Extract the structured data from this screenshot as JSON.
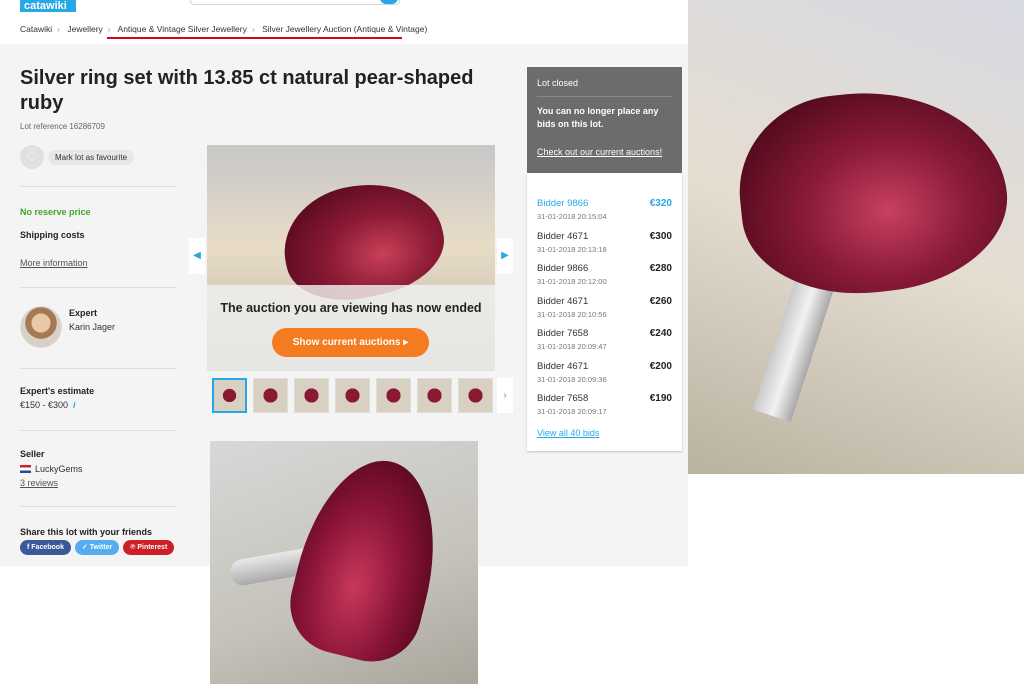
{
  "header": {
    "logo": "catawiki"
  },
  "breadcrumb": [
    "Catawiki",
    "Jewellery",
    "Antique & Vintage Silver Jewellery",
    "Silver Jewellery Auction (Antique & Vintage)"
  ],
  "lot": {
    "title": "Silver ring set with 13.85 ct natural pear-shaped ruby",
    "reference": "Lot reference 16286709",
    "favourite_label": "Mark lot as favourite",
    "no_reserve": "No reserve price",
    "shipping_label": "Shipping costs",
    "more_info": "More information"
  },
  "expert": {
    "label": "Expert",
    "name": "Karin Jager"
  },
  "estimate": {
    "label": "Expert's estimate",
    "value": "€150 - €300",
    "info_icon": "i"
  },
  "seller": {
    "label": "Seller",
    "name": "LuckyGems",
    "reviews": "3 reviews"
  },
  "share": {
    "label": "Share this lot with your friends",
    "buttons": [
      "Facebook",
      "Twitter",
      "Pinterest"
    ]
  },
  "gallery": {
    "ended_text": "The auction you are viewing has now ended",
    "show_button": "Show current auctions",
    "prev_arrow": "◀",
    "next_arrow": "▶",
    "thumb_next": "›",
    "thumb_count": 7
  },
  "status": {
    "heading": "Lot closed",
    "message": "You can no longer place any bids on this lot.",
    "link": "Check out our current auctions!"
  },
  "bids": [
    {
      "bidder": "Bidder 9866",
      "time": "31-01-2018 20:15:04",
      "amount": "€320"
    },
    {
      "bidder": "Bidder 4671",
      "time": "31-01-2018 20:13:18",
      "amount": "€300"
    },
    {
      "bidder": "Bidder 9866",
      "time": "31-01-2018 20:12:00",
      "amount": "€280"
    },
    {
      "bidder": "Bidder 4671",
      "time": "31-01-2018 20:10:56",
      "amount": "€260"
    },
    {
      "bidder": "Bidder 7658",
      "time": "31-01-2018 20:09:47",
      "amount": "€240"
    },
    {
      "bidder": "Bidder 4671",
      "time": "31-01-2018 20:09:36",
      "amount": "€200"
    },
    {
      "bidder": "Bidder 7658",
      "time": "31-01-2018 20:09:17",
      "amount": "€190"
    }
  ],
  "view_all_bids": "View all 40 bids",
  "colors": {
    "accent": "#26a8e6",
    "cta": "#f47b20",
    "no_reserve": "#43a32c",
    "highlight_line": "#e0001b"
  }
}
